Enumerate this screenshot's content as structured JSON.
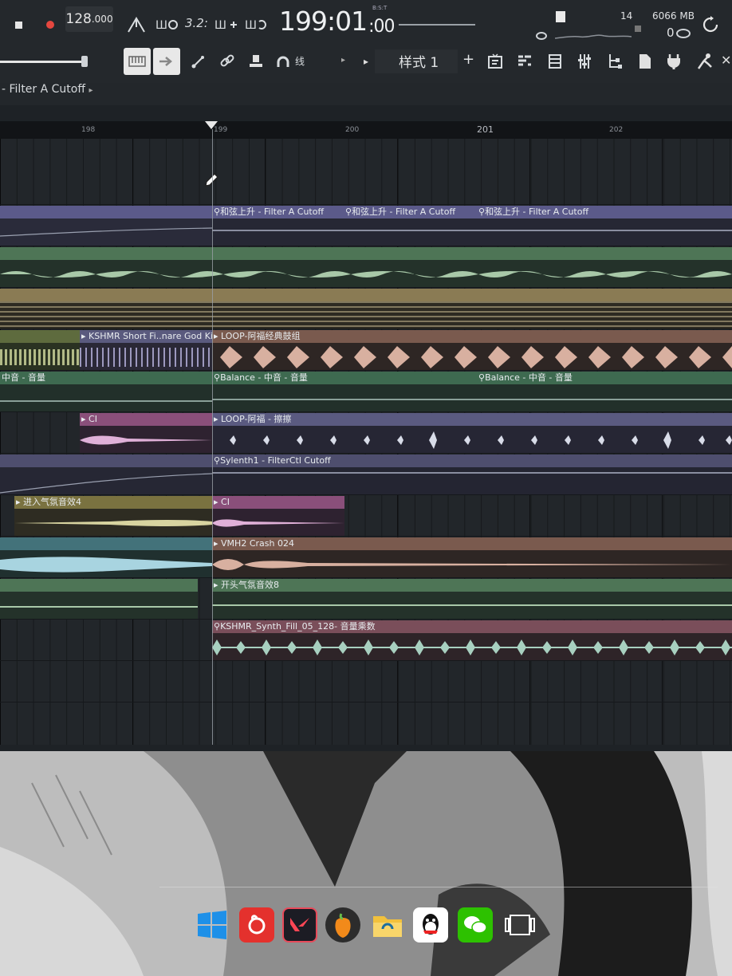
{
  "toolbar": {
    "tempo_int": "128",
    "tempo_frac": ".000",
    "pattern_num": "3.2:",
    "time_main": "199:01",
    "time_sub": ":00",
    "time_format": "B:S:T",
    "cpu_value": "14",
    "memory": "6066 MB",
    "poly_value": "0",
    "snap_label": "线",
    "style_label": "样式 1",
    "style_add": "+"
  },
  "header": {
    "path": "- Filter A Cutoff",
    "path_arrow": "▸"
  },
  "ruler": {
    "bars": [
      "198",
      "199",
      "200",
      "201",
      "202"
    ]
  },
  "clips": {
    "c1": "和弦上升 - Filter A Cutoff",
    "c2": "和弦上升 - Filter A Cutoff",
    "c3": "和弦上升 - Filter A Cutoff",
    "c4": "KSHMR Short Fi..nare God Kinda",
    "c5": "LOOP-阿福经典鼓组",
    "c6": "中音 - 音量",
    "c7": "Balance - 中音 - 音量",
    "c8": "Balance - 中音 - 音量",
    "c9": "CI",
    "c10": "LOOP-阿福 - 擦擦",
    "c11": "Sylenth1 - FilterCtl Cutoff",
    "c12": "进入气氛音效4",
    "c13": "CI",
    "c14": "VMH2 Crash 024",
    "c15": "开头气氛音效8",
    "c16": "KSHMR_Synth_Fill_05_128- 音量乘数"
  },
  "colors": {
    "purple_lane": "#5b5a8a",
    "green_lane": "#4e7556",
    "tan_lane": "#8a7b54",
    "pink_lane": "#8a4f7a",
    "teal_lane": "#43727a",
    "brown_lane": "#7a5a4e"
  },
  "taskbar": {
    "icons": [
      "windows-icon",
      "netease-music-icon",
      "valorant-icon",
      "fl-studio-icon",
      "file-explorer-icon",
      "qq-icon",
      "wechat-icon",
      "task-view-icon"
    ]
  }
}
